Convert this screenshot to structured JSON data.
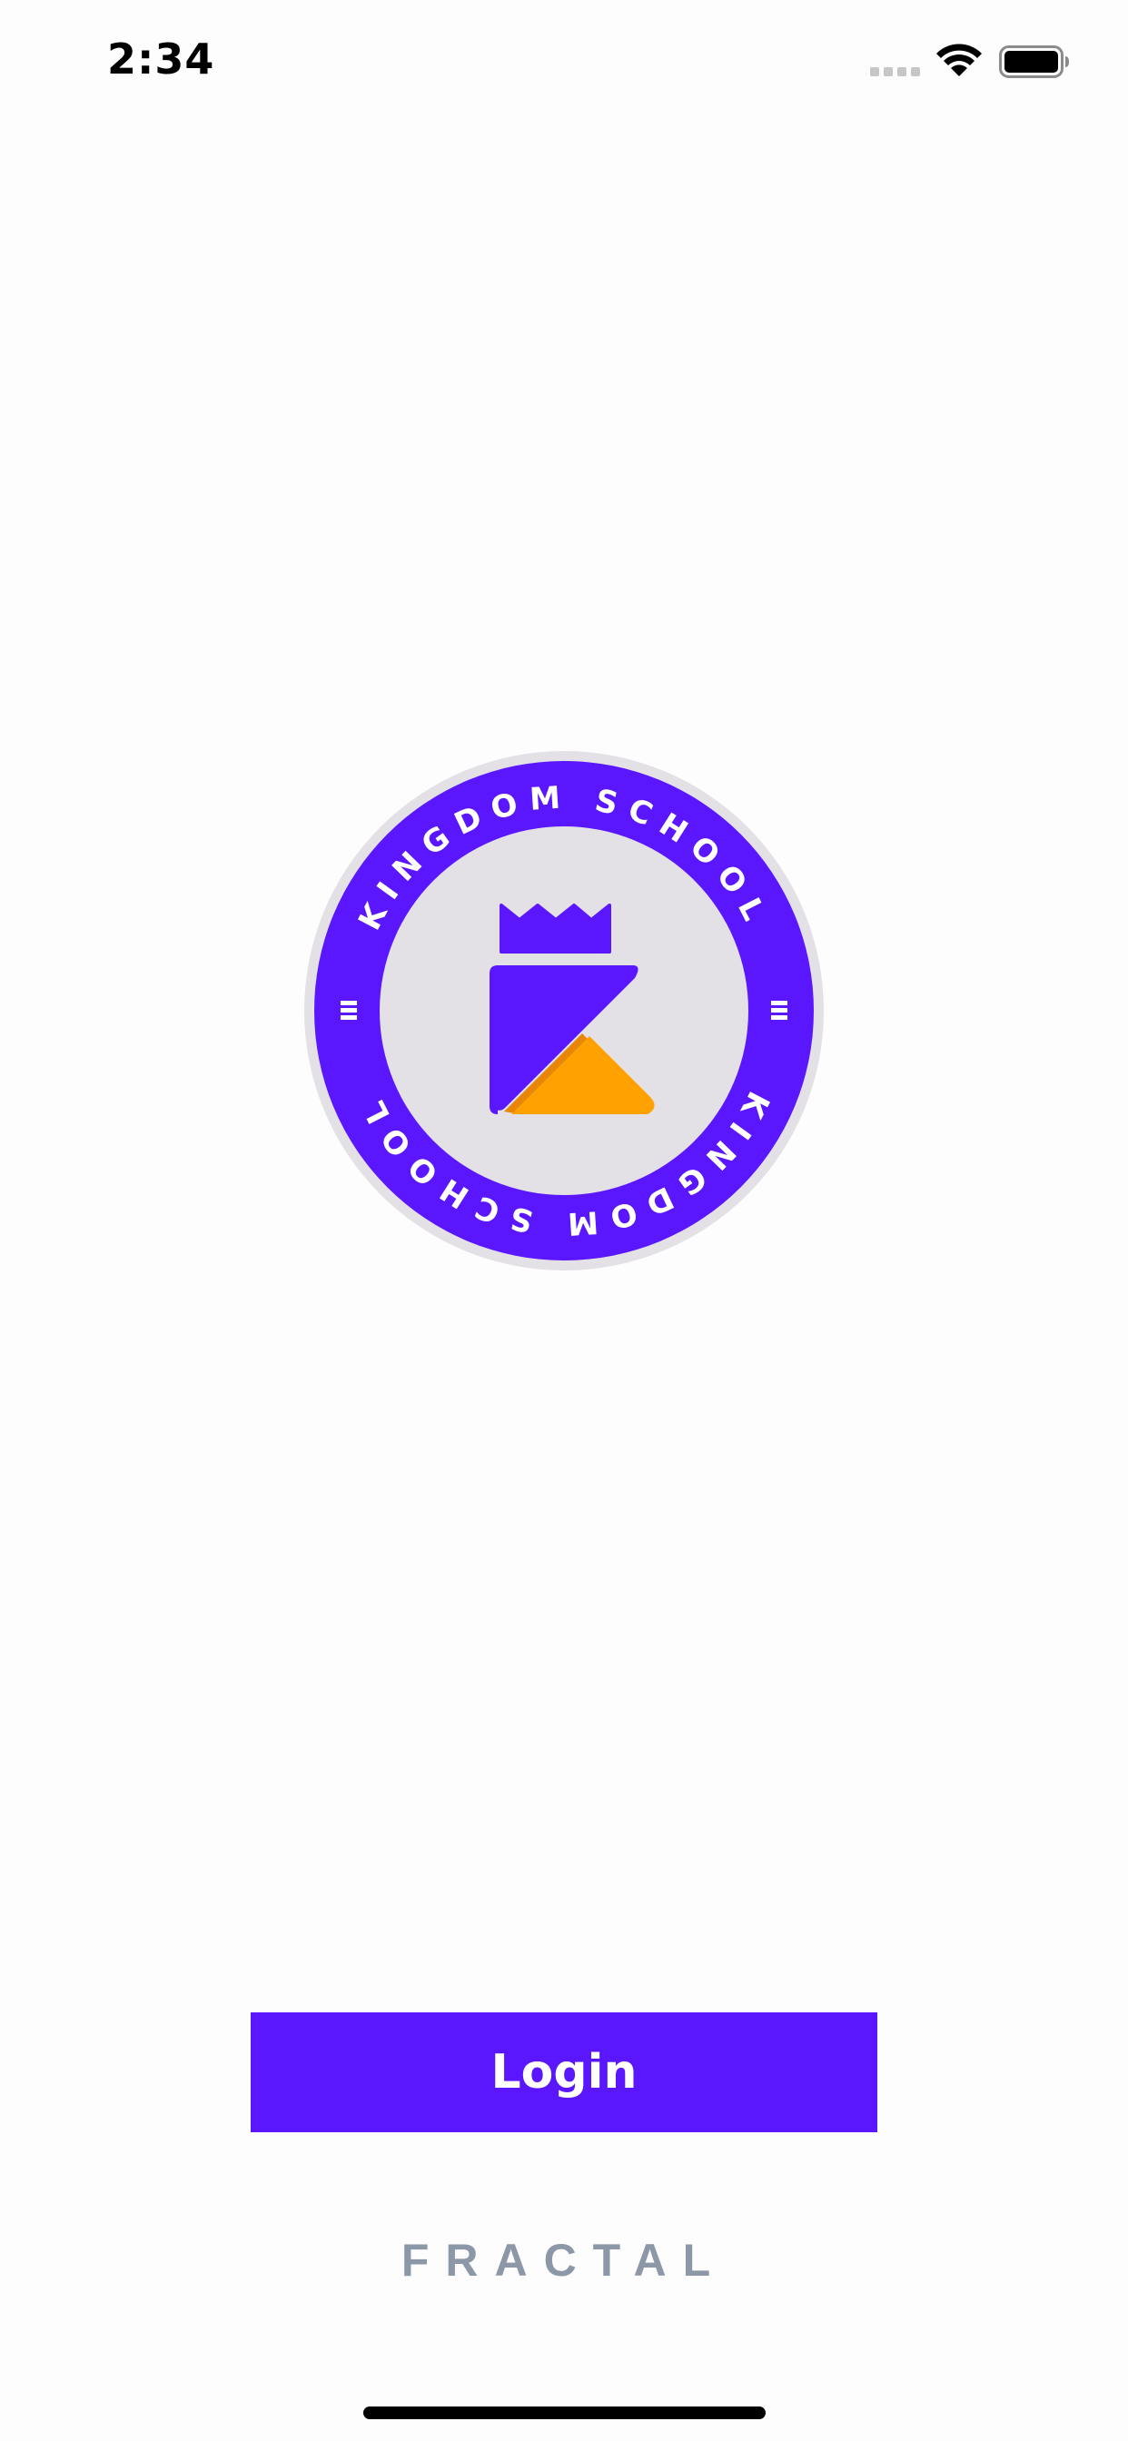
{
  "status_bar": {
    "time": "2:34",
    "signal_icon": "cellular-signal-icon",
    "wifi_icon": "wifi-icon",
    "battery_icon": "battery-icon"
  },
  "logo": {
    "ring_text_top": "KINGDOM SCHOOL",
    "ring_text_bottom": "KINGDOM SCHOOL",
    "colors": {
      "ring": "#5a17fd",
      "inner": "#e3e0e6",
      "accent": "#ffa100",
      "accent_shadow": "#e8860a",
      "outer_border": "#e3e0e6"
    }
  },
  "login": {
    "label": "Login",
    "color": "#5a17fd"
  },
  "footer": {
    "brand": "FRACTAL",
    "color": "#8c97a8"
  }
}
